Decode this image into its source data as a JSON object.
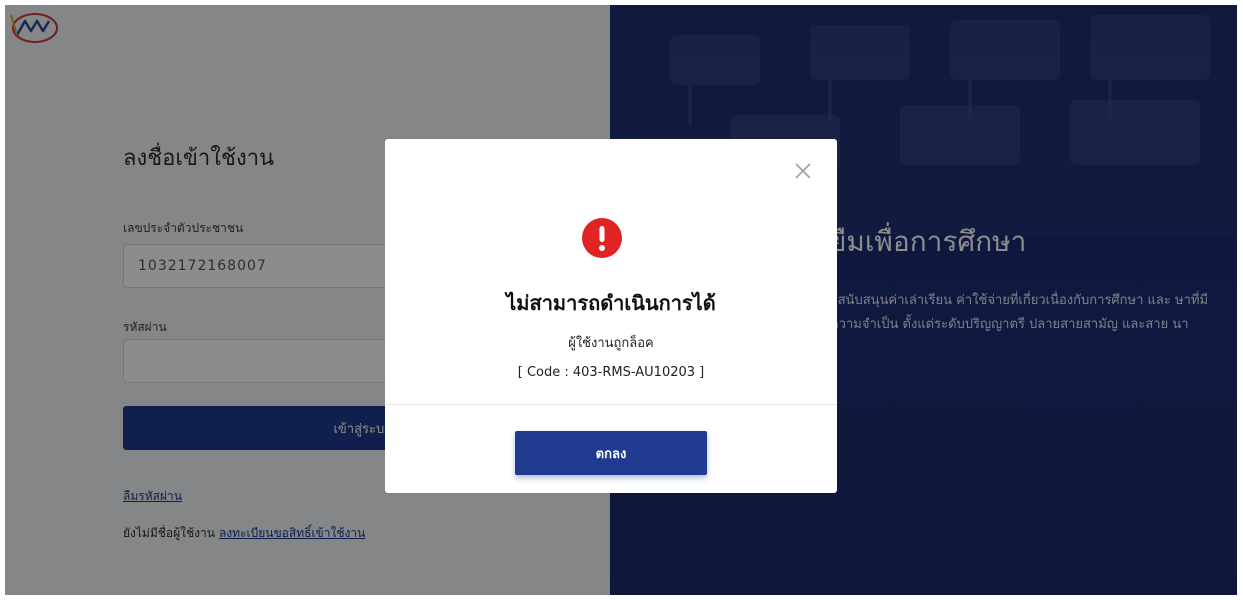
{
  "login": {
    "title": "ลงชื่อเข้าใช้งาน",
    "id_label": "เลขประจำตัวประชาชน",
    "id_value": "1032172168007",
    "password_label": "รหัสผ่าน",
    "password_value": "",
    "submit_label": "เข้าสู่ระบบ",
    "forgot_password": "ลืมรหัสผ่าน",
    "no_account_text": "ยังไม่มีชื่อผู้ใช้งาน",
    "register_link": "ลงทะเบียนขอสิทธิ์เข้าใช้งาน"
  },
  "banner": {
    "title": "ยืมเพื่อการศึกษา",
    "description": "ยสนับสนุนค่าเล่าเรียน ค่าใช้จ่ายที่เกี่ยวเนื่องกับการศึกษา และ ษาที่มีความจำเป็น ตั้งแต่ระดับปริญญาตรี ปลายสายสามัญ และสาย นา"
  },
  "modal": {
    "title": "ไม่สามารถดำเนินการได้",
    "message": "ผู้ใช้งานถูกล็อค",
    "code": "[ Code : 403-RMS-AU10203 ]",
    "ok_label": "ตกลง",
    "icon": "error-exclamation-icon",
    "close_icon": "close-icon"
  },
  "colors": {
    "primary": "#1f3a8f",
    "error": "#e02424",
    "banner_bg": "#1a2a6e"
  }
}
